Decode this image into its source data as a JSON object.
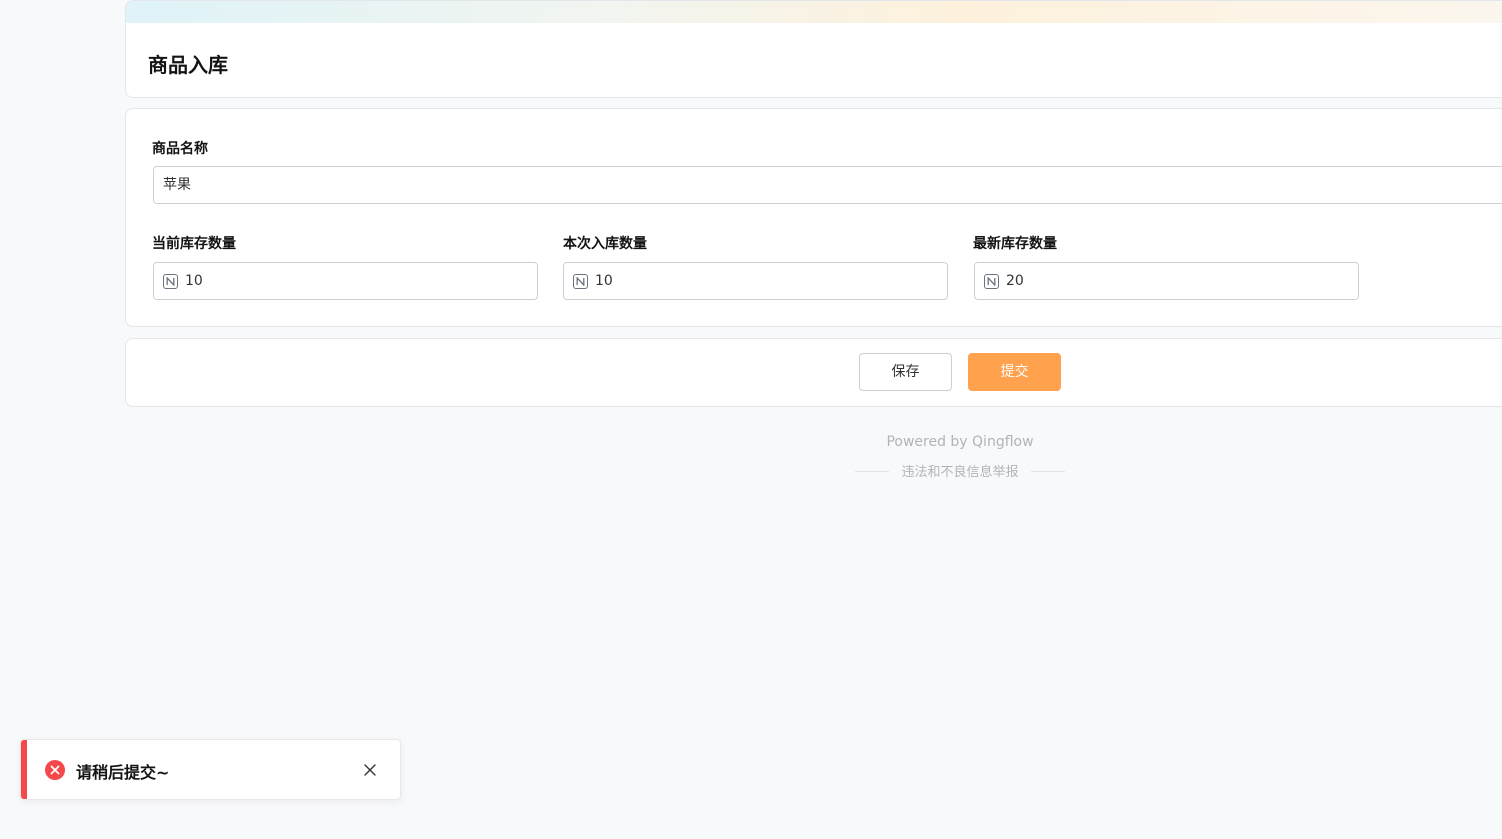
{
  "header": {
    "title": "商品入库"
  },
  "form": {
    "product_name": {
      "label": "商品名称",
      "value": "苹果"
    },
    "current_stock": {
      "label": "当前库存数量",
      "value": "10",
      "icon": "number-field-icon"
    },
    "inbound_qty": {
      "label": "本次入库数量",
      "value": "10",
      "icon": "number-field-icon"
    },
    "latest_stock": {
      "label": "最新库存数量",
      "value": "20",
      "icon": "number-field-icon"
    }
  },
  "actions": {
    "save_label": "保存",
    "submit_label": "提交"
  },
  "footer": {
    "powered": "Powered by Qingflow",
    "report": "违法和不良信息举报"
  },
  "toast": {
    "message": "请稍后提交~",
    "icon": "error-circle-icon",
    "close_icon": "close-icon"
  },
  "colors": {
    "accent": "#ffa14d",
    "error": "#f5484a",
    "background": "#f8f9fb"
  }
}
